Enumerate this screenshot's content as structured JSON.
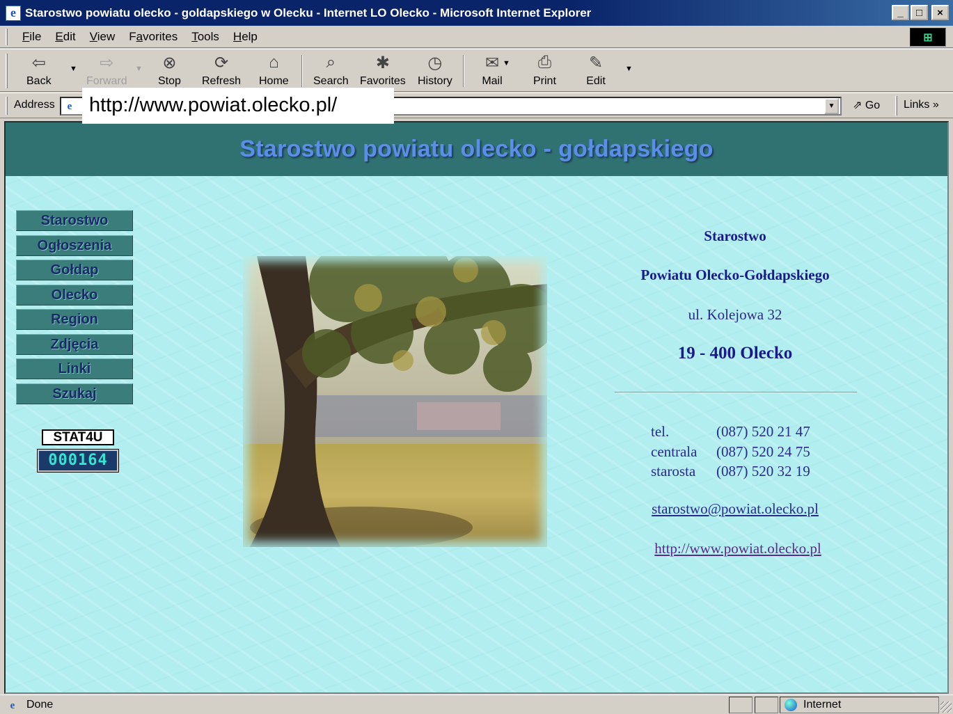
{
  "window": {
    "title": "Starostwo powiatu olecko - goldapskiego w Olecku - Internet LO Olecko - Microsoft Internet Explorer",
    "buttons": [
      "_",
      "□",
      "×"
    ]
  },
  "menu": {
    "items": [
      {
        "pre": "",
        "u": "F",
        "post": "ile"
      },
      {
        "pre": "",
        "u": "E",
        "post": "dit"
      },
      {
        "pre": "",
        "u": "V",
        "post": "iew"
      },
      {
        "pre": "F",
        "u": "a",
        "post": "vorites"
      },
      {
        "pre": "",
        "u": "T",
        "post": "ools"
      },
      {
        "pre": "",
        "u": "H",
        "post": "elp"
      }
    ]
  },
  "toolbar": {
    "back": "Back",
    "forward": "Forward",
    "stop": "Stop",
    "refresh": "Refresh",
    "home": "Home",
    "search": "Search",
    "favorites": "Favorites",
    "history": "History",
    "mail": "Mail",
    "print": "Print",
    "edit": "Edit"
  },
  "address": {
    "label": "Address",
    "url": "http://www.powiat.olecko.pl/",
    "go": "Go",
    "links": "Links"
  },
  "page": {
    "banner": "Starostwo powiatu olecko - gołdapskiego",
    "nav": [
      "Starostwo",
      "Ogłoszenia",
      "Gołdap",
      "Olecko",
      "Region",
      "Zdjęcia",
      "Linki",
      "Szukaj"
    ],
    "stat_label": "STAT4U",
    "stat_counter": "000164",
    "info": {
      "line1": "Starostwo",
      "line2": "Powiatu Olecko-Gołdapskiego",
      "line3": "ul. Kolejowa 32",
      "line4": "19 - 400 Olecko",
      "contacts": [
        {
          "k": "tel.",
          "v": "(087) 520 21 47"
        },
        {
          "k": "centrala",
          "v": "(087) 520 24 75"
        },
        {
          "k": "starosta",
          "v": "(087) 520 32 19"
        }
      ],
      "email": "starostwo@powiat.olecko.pl",
      "www": "http://www.powiat.olecko.pl"
    }
  },
  "status": {
    "text": "Done",
    "zone": "Internet"
  }
}
